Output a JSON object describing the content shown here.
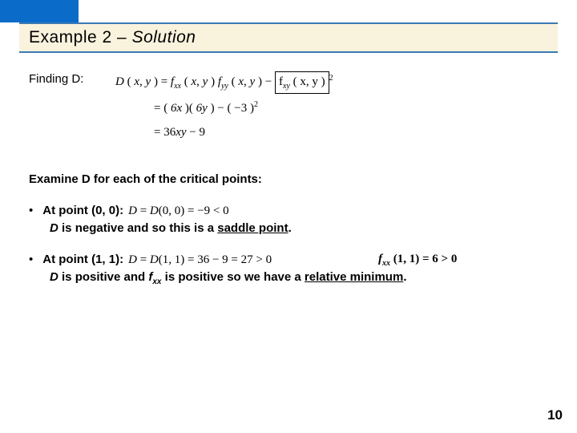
{
  "title": {
    "prefix": "Example 2 – ",
    "suffix": "Solution"
  },
  "finding_label": "Finding D:",
  "eq1": "D ( x, y ) = f_xx ( x, y ) f_yy ( x, y ) − [ f_xy ( x, y ) ]²",
  "eq2": "= ( 6x )( 6y ) − ( −3 )²",
  "eq3": "= 36xy − 9",
  "examine": "Examine D for each of the critical points:",
  "point1": {
    "label": "At point (0, 0):",
    "inline": "D = D(0, 0) = −9 < 0",
    "sub_pre": "D",
    "sub_mid": " is negative and so this is a ",
    "sub_und": "saddle point",
    "sub_post": "."
  },
  "point2": {
    "label": "At point (1, 1):",
    "inline": "D = D(1, 1) = 36 − 9 = 27 > 0",
    "extra": "f_xx (1, 1) = 6 > 0",
    "sub_pre": "D",
    "sub_mid1": " is positive and ",
    "sub_fxx": "f",
    "sub_fxx_sub": "xx",
    "sub_mid2": " is positive so we have a ",
    "sub_und": "relative minimum",
    "sub_post": "."
  },
  "page": "10"
}
